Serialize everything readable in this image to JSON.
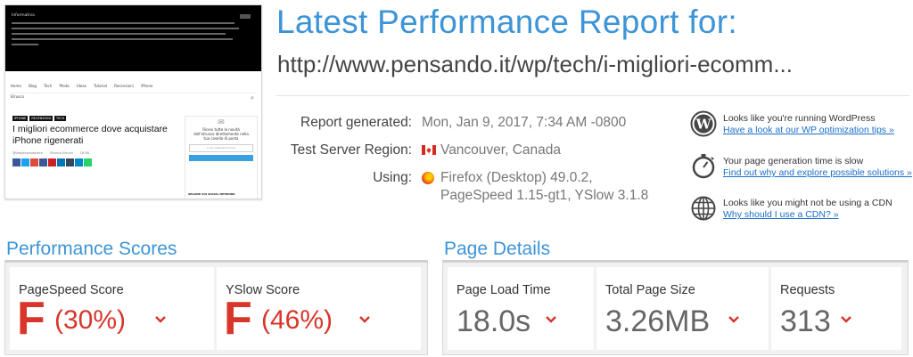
{
  "thumbnail": {
    "cookie_title": "Informativa",
    "nav_items": [
      "Home",
      "Blog",
      "Tech",
      "Photo",
      "Ideas",
      "Tutorial",
      "Recensioni",
      "iPhone"
    ],
    "nav_user": "Etrusco",
    "article_tags": [
      "IPHONE",
      "RECENSIONI",
      "TECH"
    ],
    "article_title": "I migliori ecommerce dove acquistare iPhone rigenerati",
    "article_meta": [
      "@thepensandotech",
      "Etrusco Etruca",
      "18 KB"
    ],
    "share_colors": [
      "#3b5998",
      "#1da1f2",
      "#dd4b39",
      "#3b5998",
      "#cb2027",
      "#0077b5",
      "#35465c",
      "#0088cc",
      "#25d366"
    ],
    "sidebar_text": "Ricevi tutte le novità dell'etrusco direttamente nella tua casella di posta",
    "sidebar_input": "Il tuo indirizzo E-mail",
    "sidebar_section": "SEGUIMI SUI SOCIAL NETWORK"
  },
  "header": {
    "title": "Latest Performance Report for:",
    "url": "http://www.pensando.it/wp/tech/i-migliori-ecomm..."
  },
  "report": {
    "generated_label": "Report generated:",
    "generated_value": "Mon, Jan 9, 2017, 7:34 AM -0800",
    "region_label": "Test Server Region:",
    "region_value": "Vancouver, Canada",
    "using_label": "Using:",
    "using_value_1": "Firefox (Desktop) 49.0.2,",
    "using_value_2": "PageSpeed 1.15-gt1, YSlow 3.1.8"
  },
  "tips": [
    {
      "icon": "wordpress-icon",
      "text": "Looks like you're running WordPress",
      "link": "Have a look at our WP optimization tips »"
    },
    {
      "icon": "stopwatch-icon",
      "text": "Your page generation time is slow",
      "link": "Find out why and explore possible solutions »"
    },
    {
      "icon": "globe-icon",
      "text": "Looks like you might not be using a CDN",
      "link": "Why should I use a CDN? »"
    }
  ],
  "performance": {
    "title": "Performance Scores",
    "pagespeed": {
      "label": "PageSpeed Score",
      "grade": "F",
      "percent": "(30%)"
    },
    "yslow": {
      "label": "YSlow Score",
      "grade": "F",
      "percent": "(46%)"
    }
  },
  "details": {
    "title": "Page Details",
    "load_time": {
      "label": "Page Load Time",
      "value": "18.0s"
    },
    "page_size": {
      "label": "Total Page Size",
      "value": "3.26MB"
    },
    "requests": {
      "label": "Requests",
      "value": "313"
    }
  },
  "colors": {
    "accent": "#3d94d6",
    "grade_fail": "#d8362a",
    "link": "#1a6ec8"
  }
}
